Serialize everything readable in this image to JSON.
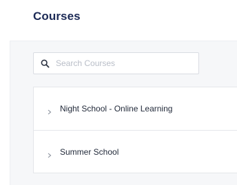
{
  "header": {
    "title": "Courses"
  },
  "search": {
    "placeholder": "Search Courses",
    "value": "",
    "icon": "search-icon"
  },
  "courses": {
    "items": [
      {
        "label": "Night School - Online Learning",
        "icon": "chevron-right-icon"
      },
      {
        "label": "Summer School",
        "icon": "chevron-right-icon"
      }
    ]
  },
  "colors": {
    "title": "#1c2a56",
    "panel_background": "#f6f7f9",
    "border": "#e4e6ea",
    "placeholder": "#b9bec8"
  }
}
